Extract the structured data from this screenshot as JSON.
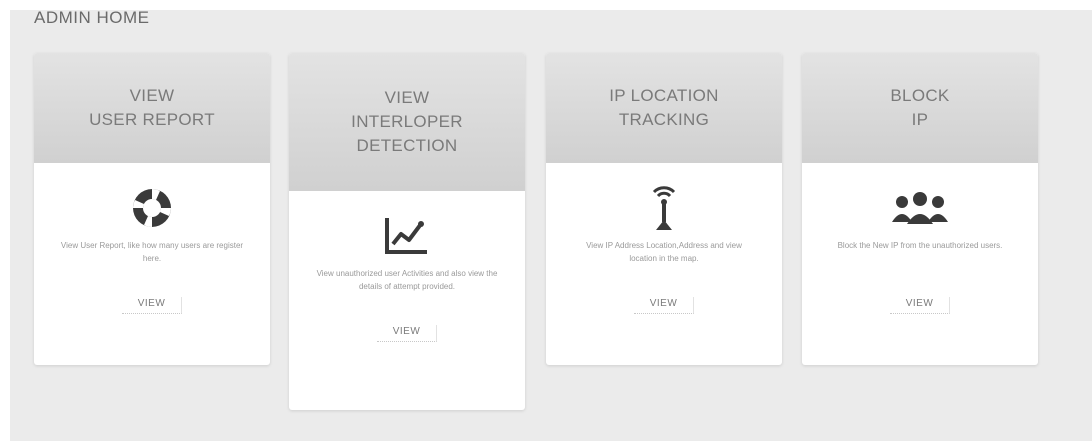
{
  "page": {
    "title": "ADMIN HOME"
  },
  "cards": [
    {
      "title_line1": "VIEW",
      "title_line2": "USER REPORT",
      "title_line3": "",
      "icon": "lifebuoy-icon",
      "description": "View User Report, like how many users are register here.",
      "button_label": "VIEW"
    },
    {
      "title_line1": "VIEW",
      "title_line2": "INTERLOPER",
      "title_line3": "DETECTION",
      "icon": "line-chart-icon",
      "description": "View unauthorized user Activities and also view the details of attempt provided.",
      "button_label": "VIEW"
    },
    {
      "title_line1": "IP LOCATION",
      "title_line2": "TRACKING",
      "title_line3": "",
      "icon": "signal-tower-icon",
      "description": "View IP Address Location,Address and view location in the map.",
      "button_label": "VIEW"
    },
    {
      "title_line1": "BLOCK",
      "title_line2": "IP",
      "title_line3": "",
      "icon": "users-group-icon",
      "description": "Block the New IP from the unauthorized users.",
      "button_label": "VIEW"
    }
  ],
  "colors": {
    "panel_bg": "#ebebeb",
    "card_head": "#d9d9d9",
    "text_gray": "#7a7a7a"
  }
}
